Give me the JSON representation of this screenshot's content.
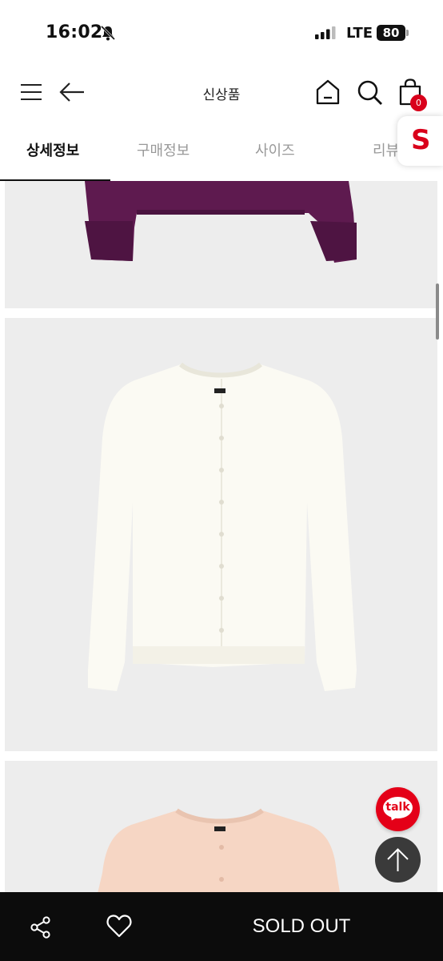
{
  "status_bar": {
    "time": "16:02",
    "network": "LTE",
    "battery": "80"
  },
  "header": {
    "title": "신상품",
    "cart_count": "0",
    "icons": [
      "menu-icon",
      "back-arrow-icon",
      "home-icon",
      "search-icon",
      "cart-icon"
    ]
  },
  "tabs": [
    {
      "label": "상세정보",
      "active": true
    },
    {
      "label": "구매정보",
      "active": false
    },
    {
      "label": "사이즈",
      "active": false
    },
    {
      "label": "리뷰",
      "active": false
    }
  ],
  "brand_badge": {
    "label": "S",
    "color": "#d9001b"
  },
  "products_images": [
    {
      "color_name": "purple",
      "color": "#5e1a4f"
    },
    {
      "color_name": "ivory",
      "color": "#fbfaf3"
    },
    {
      "color_name": "peach",
      "color": "#f6d6c4"
    }
  ],
  "floating": {
    "talk_label": "talk",
    "talk_color": "#e40018",
    "top_icon": "arrow-up-icon"
  },
  "bottom_bar": {
    "share_icon": "share-icon",
    "wishlist_icon": "heart-icon",
    "action_label": "SOLD OUT"
  }
}
